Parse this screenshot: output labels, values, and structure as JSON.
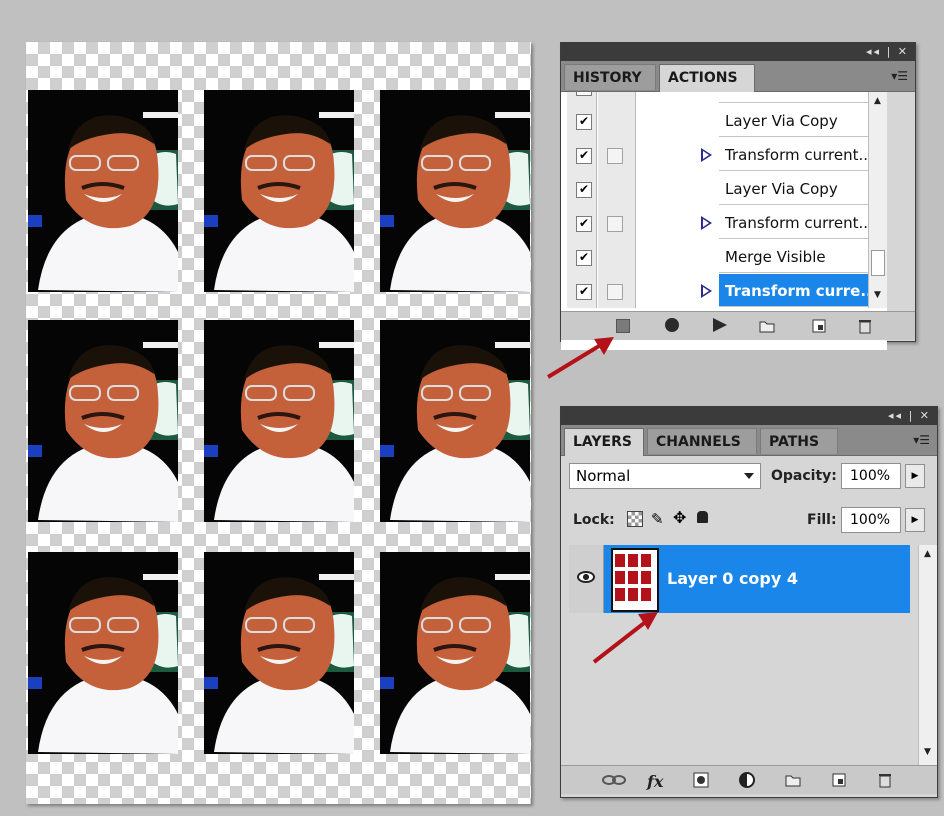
{
  "history_actions_panel": {
    "tabs": [
      "HISTORY",
      "ACTIONS"
    ],
    "active_tab": "ACTIONS",
    "window_controls": "◂◂ | ✕",
    "menu": "▾☰",
    "rows": [
      {
        "label": "",
        "checked": true,
        "dialog": false,
        "expandable": false
      },
      {
        "label": "Layer Via Copy",
        "checked": true,
        "dialog": false,
        "expandable": false
      },
      {
        "label": "Transform current...",
        "checked": true,
        "dialog": true,
        "expandable": true
      },
      {
        "label": "Layer Via Copy",
        "checked": true,
        "dialog": false,
        "expandable": false
      },
      {
        "label": "Transform current...",
        "checked": true,
        "dialog": true,
        "expandable": true
      },
      {
        "label": "Merge Visible",
        "checked": true,
        "dialog": false,
        "expandable": false
      },
      {
        "label": "Transform curre...",
        "checked": true,
        "dialog": true,
        "expandable": true,
        "selected": true
      }
    ],
    "buttons": [
      "stop-icon",
      "record-icon",
      "play-icon",
      "folder-icon",
      "new-action-icon",
      "trash-icon"
    ]
  },
  "layers_panel": {
    "tabs": [
      "LAYERS",
      "CHANNELS",
      "PATHS"
    ],
    "active_tab": "LAYERS",
    "window_controls": "◂◂ | ✕",
    "menu": "▾☰",
    "blend_mode": "Normal",
    "opacity_label": "Opacity:",
    "opacity_value": "100%",
    "lock_label": "Lock:",
    "fill_label": "Fill:",
    "fill_value": "100%",
    "layer_name": "Layer 0 copy 4",
    "buttons": [
      "link-icon",
      "fx-icon",
      "mask-icon",
      "adjustment-icon",
      "folder-icon",
      "new-layer-icon",
      "trash-icon"
    ],
    "fx_label": "fx"
  },
  "canvas": {
    "rows": 3,
    "cols": 3,
    "background": "transparent-checkerboard"
  },
  "colors": {
    "selection": "#1a86ea",
    "annotation_arrow": "#b3121b"
  }
}
